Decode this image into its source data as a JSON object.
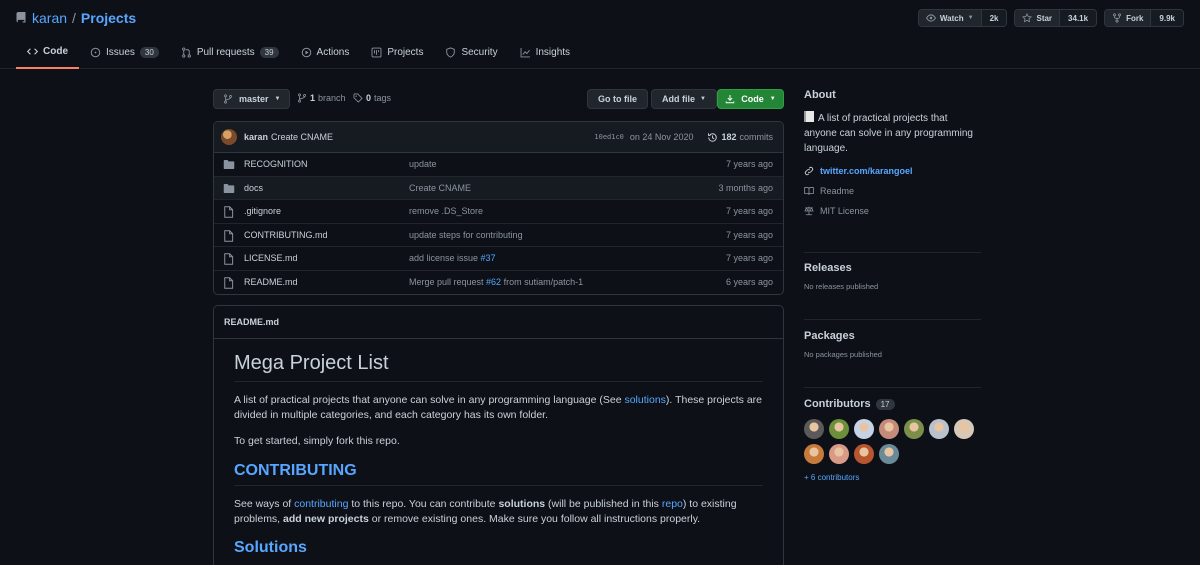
{
  "repo": {
    "owner": "karan",
    "separator": "/",
    "name": "Projects"
  },
  "actions": {
    "watch": {
      "label": "Watch",
      "count": "2k"
    },
    "star": {
      "label": "Star",
      "count": "34.1k"
    },
    "fork": {
      "label": "Fork",
      "count": "9.9k"
    }
  },
  "tabs": [
    {
      "label": "Code",
      "icon": "code-icon",
      "active": true
    },
    {
      "label": "Issues",
      "icon": "issue-icon",
      "count": "30"
    },
    {
      "label": "Pull requests",
      "icon": "pull-request-icon",
      "count": "39"
    },
    {
      "label": "Actions",
      "icon": "play-icon"
    },
    {
      "label": "Projects",
      "icon": "project-icon"
    },
    {
      "label": "Security",
      "icon": "shield-icon"
    },
    {
      "label": "Insights",
      "icon": "graph-icon"
    }
  ],
  "toolbar": {
    "branch": "master",
    "branch_count": "1",
    "branch_word": "branch",
    "tag_count": "0",
    "tag_word": "tags",
    "go_to_file": "Go to file",
    "add_file": "Add file",
    "code": "Code"
  },
  "latest_commit": {
    "author": "karan",
    "message": "Create CNAME",
    "sha": "10ed1c0",
    "date": "on 24 Nov 2020",
    "commit_count": "182",
    "commit_word": "commits"
  },
  "files": [
    {
      "type": "dir",
      "name": "RECOGNITION",
      "msg": "update",
      "age": "7 years ago"
    },
    {
      "type": "dir",
      "name": "docs",
      "msg": "Create CNAME",
      "age": "3 months ago"
    },
    {
      "type": "file",
      "name": ".gitignore",
      "msg": "remove .DS_Store",
      "age": "7 years ago"
    },
    {
      "type": "file",
      "name": "CONTRIBUTING.md",
      "msg": "update steps for contributing",
      "age": "7 years ago"
    },
    {
      "type": "file",
      "name": "LICENSE.md",
      "msg_pre": "add license issue ",
      "msg_link": "#37",
      "msg_post": "",
      "age": "7 years ago"
    },
    {
      "type": "file",
      "name": "README.md",
      "msg_pre": "Merge pull request ",
      "msg_link": "#62",
      "msg_post": " from sutiam/patch-1",
      "age": "6 years ago"
    }
  ],
  "readme": {
    "filename": "README.md",
    "title": "Mega Project List",
    "intro_pre": "A list of practical projects that anyone can solve in any programming language (See ",
    "intro_link": "solutions",
    "intro_post": "). These projects are divided in multiple categories, and each category has its own folder.",
    "get_started": "To get started, simply fork this repo.",
    "contributing_heading": "CONTRIBUTING",
    "contrib_1": "See ways of ",
    "contrib_link1": "contributing",
    "contrib_2": " to this repo. You can contribute ",
    "contrib_bold1": "solutions",
    "contrib_3": " (will be published in this ",
    "contrib_link2": "repo",
    "contrib_4": ") to existing problems, ",
    "contrib_bold2": "add new projects",
    "contrib_5": " or remove existing ones. Make sure you follow all instructions properly.",
    "solutions_heading": "Solutions"
  },
  "about": {
    "heading": "About",
    "description": "A list of practical projects that anyone can solve in any programming language.",
    "website": "twitter.com/karangoel",
    "readme": "Readme",
    "license": "MIT License"
  },
  "releases": {
    "heading": "Releases",
    "empty": "No releases published"
  },
  "packages": {
    "heading": "Packages",
    "empty": "No packages published"
  },
  "contributors": {
    "heading": "Contributors",
    "count": "17",
    "more": "+ 6 contributors",
    "avatar_colors": [
      "#5a5a5a",
      "#6b8f3a",
      "#c6d2e6",
      "#c48a7a",
      "#7b8f4a",
      "#b9c2cc",
      "#d7c8b8",
      "#c77a3a",
      "#d99a88",
      "#b7552e",
      "#6a8a9a"
    ]
  },
  "colors": {
    "accent": "#58a6ff",
    "green": "#238636",
    "bg": "#0d1117",
    "tab_underline": "#f78166"
  }
}
